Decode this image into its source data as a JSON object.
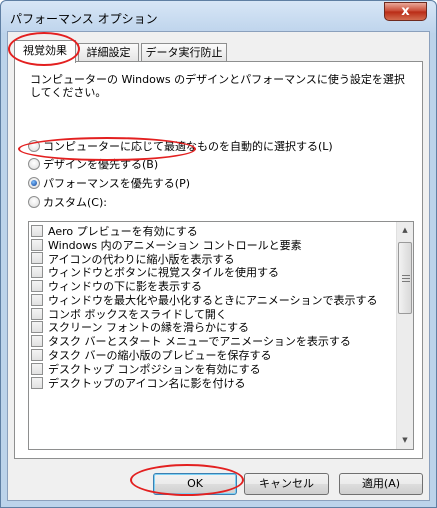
{
  "window": {
    "title": "パフォーマンス オプション",
    "close_glyph": "x"
  },
  "tabs": [
    {
      "label": "視覚効果",
      "active": true
    },
    {
      "label": "詳細設定",
      "active": false
    },
    {
      "label": "データ実行防止",
      "active": false
    }
  ],
  "visual_effects": {
    "description": "コンピューターの Windows のデザインとパフォーマンスに使う設定を選択してください。",
    "radio_options": [
      {
        "label": "コンピューターに応じて最適なものを自動的に選択する(L)",
        "checked": false
      },
      {
        "label": "デザインを優先する(B)",
        "checked": false
      },
      {
        "label": "パフォーマンスを優先する(P)",
        "checked": true
      },
      {
        "label": "カスタム(C):",
        "checked": false
      }
    ],
    "effects": [
      {
        "label": "Aero プレビューを有効にする",
        "checked": false
      },
      {
        "label": "Windows 内のアニメーション コントロールと要素",
        "checked": false
      },
      {
        "label": "アイコンの代わりに縮小版を表示する",
        "checked": false
      },
      {
        "label": "ウィンドウとボタンに視覚スタイルを使用する",
        "checked": false
      },
      {
        "label": "ウィンドウの下に影を表示する",
        "checked": false
      },
      {
        "label": "ウィンドウを最大化や最小化するときにアニメーションで表示する",
        "checked": false
      },
      {
        "label": "コンボ ボックスをスライドして開く",
        "checked": false
      },
      {
        "label": "スクリーン フォントの縁を滑らかにする",
        "checked": false
      },
      {
        "label": "タスク バーとスタート メニューでアニメーションを表示する",
        "checked": false
      },
      {
        "label": "タスク バーの縮小版のプレビューを保存する",
        "checked": false
      },
      {
        "label": "デスクトップ コンポジションを有効にする",
        "checked": false
      },
      {
        "label": "デスクトップのアイコン名に影を付ける",
        "checked": false
      }
    ]
  },
  "buttons": {
    "ok": "OK",
    "cancel": "キャンセル",
    "apply": "適用(A)"
  },
  "scrollbar": {
    "up_glyph": "▲",
    "down_glyph": "▼"
  },
  "colors": {
    "annotation": "#e32020",
    "title_gradient": "#bed4ec",
    "close_button": "#c7442f"
  }
}
